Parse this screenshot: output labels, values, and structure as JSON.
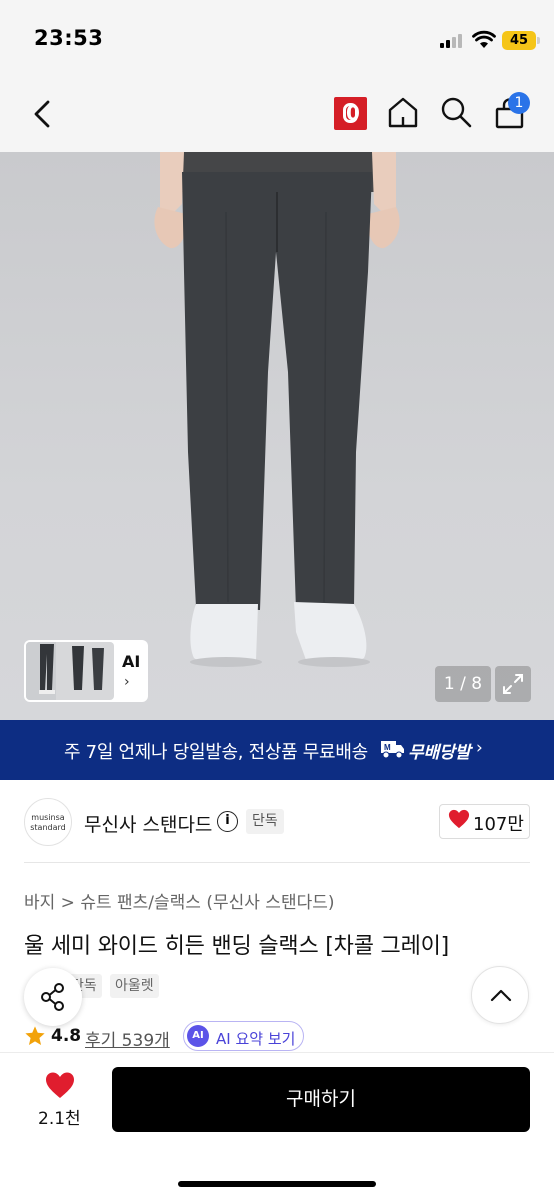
{
  "status_bar": {
    "time": "23:53",
    "battery": "45"
  },
  "nav": {
    "zero_badge": "0",
    "cart_count": "1"
  },
  "gallery": {
    "thumb_label": "AI",
    "thumb_arrow": "›",
    "counter": "1 / 8"
  },
  "banner": {
    "text": "주 7일 언제나 당일발송, 전상품 무료배송",
    "brand": "무배당발",
    "chevron": "›"
  },
  "brand": {
    "logo_line1": "musinsa",
    "logo_line2": "standard",
    "name": "무신사 스탠다드",
    "info": "i",
    "tag": "단독",
    "likes": "107만"
  },
  "product": {
    "breadcrumb": "바지 > 슈트 팬츠/슬랙스 (무신사 스탠다드)",
    "title": "울 세미 와이드 히든 밴딩 슬랙스 [차콜 그레이]",
    "tags": [
      "단독",
      "아울렛"
    ],
    "rating": "4.8",
    "review_link": "후기 539개",
    "ai_badge": "AI",
    "ai_summary": "AI 요약 보기"
  },
  "bottom": {
    "wish_count": "2.1천",
    "buy_label": "구매하기"
  },
  "colors": {
    "accent_red": "#d51e26",
    "banner_navy": "#0d2d83",
    "ai_purple": "#5b53e8",
    "cart_badge_blue": "#2a73e8",
    "star": "#f2a20a"
  },
  "icons": [
    "chevron-left-icon",
    "zero-badge-icon",
    "home-icon",
    "search-icon",
    "bag-icon",
    "expand-icon",
    "truck-icon",
    "info-icon",
    "heart-icon",
    "share-icon",
    "chevron-up-icon",
    "star-icon"
  ]
}
